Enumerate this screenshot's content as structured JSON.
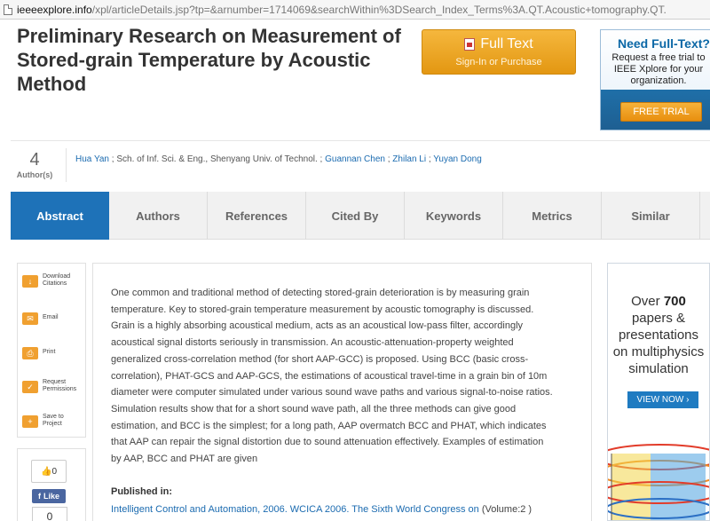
{
  "address_bar": {
    "host": "ieeeexplore.info",
    "path": "/xpl/articleDetails.jsp?tp=&arnumber=1714069&searchWithin%3DSearch_Index_Terms%3A.QT.Acoustic+tomography.QT."
  },
  "title": "Preliminary Research on Measurement of Stored-grain Temperature by Acoustic Method",
  "full_text": {
    "main": "Full Text",
    "sub": "Sign-In or Purchase"
  },
  "need_full_text": {
    "heading": "Need Full-Text?",
    "body": "Request a free trial to IEEE Xplore for your organization.",
    "button": "FREE TRIAL"
  },
  "authors": {
    "count": "4",
    "count_label": "Author(s)",
    "first": "Hua Yan",
    "affiliation": "; Sch. of Inf. Sci. & Eng., Shenyang Univ. of Technol. ;",
    "second": "Guannan Chen",
    "sep1": ";",
    "third": "Zhilan Li",
    "sep2": ";",
    "fourth": "Yuyan Dong"
  },
  "tabs": [
    "Abstract",
    "Authors",
    "References",
    "Cited By",
    "Keywords",
    "Metrics",
    "Similar"
  ],
  "tools": [
    {
      "label": "Download Citations",
      "icon": "download-icon"
    },
    {
      "label": "Email",
      "icon": "email-icon"
    },
    {
      "label": "Print",
      "icon": "print-icon"
    },
    {
      "label": "Request Permissions",
      "icon": "permissions-icon"
    },
    {
      "label": "Save to Project",
      "icon": "save-icon"
    }
  ],
  "social": {
    "likes": "0",
    "fb_like": "Like",
    "fb_count": "0"
  },
  "abstract": "One common and traditional method of detecting stored-grain deterioration is by measuring grain temperature. Key to stored-grain temperature measurement by acoustic tomography is discussed. Grain is a highly absorbing acoustical medium, acts as an acoustical low-pass filter, accordingly acoustical signal distorts seriously in transmission. An acoustic-attenuation-property weighted generalized cross-correlation method (for short AAP-GCC) is proposed. Using BCC (basic cross-correlation), PHAT-GCS and AAP-GCS, the estimations of acoustical travel-time in a grain bin of 10m diameter were computer simulated under various sound wave paths and various signal-to-noise ratios. Simulation results show that for a short sound wave path, all the three methods can give good estimation, and BCC is the simplest; for a long path, AAP overmatch BCC and PHAT, which indicates that AAP can repair the signal distortion due to sound attenuation effectively. Examples of estimation by AAP, BCC and PHAT are given",
  "published": {
    "label": "Published in:",
    "link": "Intelligent Control and Automation, 2006. WCICA 2006. The Sixth World Congress on",
    "volume": "(Volume:2 )"
  },
  "ad": {
    "over": "Over",
    "number": "700",
    "line2": "papers &",
    "line3": "presentations",
    "line4": "on multiphysics",
    "line5": "simulation",
    "button": "VIEW NOW ›"
  }
}
